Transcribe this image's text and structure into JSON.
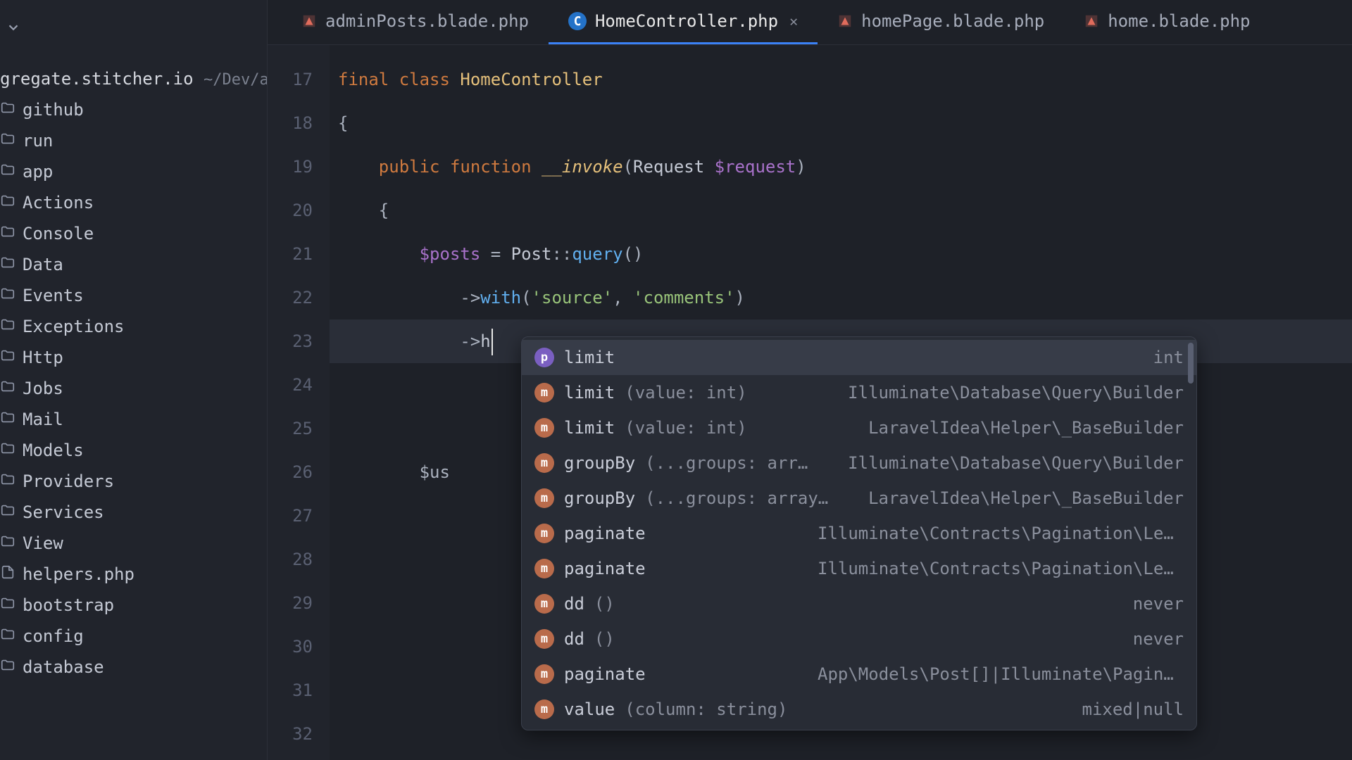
{
  "project": {
    "name": "gregate.stitcher.io",
    "path": "~/Dev/aggre"
  },
  "sidebar_items": [
    {
      "label": "github",
      "kind": "folder"
    },
    {
      "label": "run",
      "kind": "folder"
    },
    {
      "label": "app",
      "kind": "folder"
    },
    {
      "label": "Actions",
      "kind": "folder"
    },
    {
      "label": "Console",
      "kind": "folder"
    },
    {
      "label": "Data",
      "kind": "folder"
    },
    {
      "label": "Events",
      "kind": "folder"
    },
    {
      "label": "Exceptions",
      "kind": "folder"
    },
    {
      "label": "Http",
      "kind": "folder"
    },
    {
      "label": "Jobs",
      "kind": "folder"
    },
    {
      "label": "Mail",
      "kind": "folder"
    },
    {
      "label": "Models",
      "kind": "folder"
    },
    {
      "label": "Providers",
      "kind": "folder"
    },
    {
      "label": "Services",
      "kind": "folder"
    },
    {
      "label": "View",
      "kind": "folder"
    },
    {
      "label": "helpers.php",
      "kind": "file"
    },
    {
      "label": "bootstrap",
      "kind": "folder"
    },
    {
      "label": "config",
      "kind": "folder"
    },
    {
      "label": "database",
      "kind": "folder"
    }
  ],
  "tabs": [
    {
      "label": "adminPosts.blade.php",
      "icon": "blade",
      "active": false,
      "closable": false
    },
    {
      "label": "HomeController.php",
      "icon": "class",
      "active": true,
      "closable": true
    },
    {
      "label": "homePage.blade.php",
      "icon": "blade",
      "active": false,
      "closable": false
    },
    {
      "label": "home.blade.php",
      "icon": "blade",
      "active": false,
      "closable": false
    }
  ],
  "line_numbers": [
    "17",
    "18",
    "19",
    "20",
    "21",
    "22",
    "23",
    "24",
    "25",
    "26",
    "27",
    "28",
    "29",
    "30",
    "31",
    "32"
  ],
  "code": {
    "l17": {
      "kw1": "final",
      "kw2": "class",
      "name": "HomeController"
    },
    "l18": "{",
    "l19": {
      "kw1": "public",
      "kw2": "function",
      "fn": "__invoke",
      "paren_open": "(",
      "type": "Request",
      "var": "$request",
      "paren_close": ")"
    },
    "l20": "    {",
    "l21": {
      "var": "$posts",
      "eq": " = ",
      "cls": "Post",
      "scope": "::",
      "m": "query",
      "call": "()"
    },
    "l22": {
      "arrow": "->",
      "m": "with",
      "open": "(",
      "s1": "'source'",
      "comma": ", ",
      "s2": "'comments'",
      "close": ")"
    },
    "l23": {
      "arrow": "->",
      "typed": "h"
    },
    "l26_var": "$us"
  },
  "autocomplete": [
    {
      "badge": "p",
      "name": "limit",
      "sig": "",
      "right": "int"
    },
    {
      "badge": "m",
      "name": "limit",
      "sig": "(value: int)",
      "right": "Illuminate\\Database\\Query\\Builder"
    },
    {
      "badge": "m",
      "name": "limit",
      "sig": "(value: int)",
      "right": "LaravelIdea\\Helper\\_BaseBuilder"
    },
    {
      "badge": "m",
      "name": "groupBy",
      "sig": "(...groups: arr…",
      "right": "Illuminate\\Database\\Query\\Builder"
    },
    {
      "badge": "m",
      "name": "groupBy",
      "sig": "(...groups: array…",
      "right": "LaravelIdea\\Helper\\_BaseBuilder"
    },
    {
      "badge": "m",
      "name": "paginate",
      "sig": "",
      "right": "Illuminate\\Contracts\\Pagination\\LengthAwarePagi…"
    },
    {
      "badge": "m",
      "name": "paginate",
      "sig": "",
      "right": "Illuminate\\Contracts\\Pagination\\LengthAwarePagi…"
    },
    {
      "badge": "m",
      "name": "dd",
      "sig": "()",
      "right": "never"
    },
    {
      "badge": "m",
      "name": "dd",
      "sig": "()",
      "right": "never"
    },
    {
      "badge": "m",
      "name": "paginate",
      "sig": "",
      "right": "App\\Models\\Post[]|Illuminate\\Pagination\\LengthA…"
    },
    {
      "badge": "m",
      "name": "value",
      "sig": "(column: string)",
      "right": "mixed|null"
    }
  ]
}
